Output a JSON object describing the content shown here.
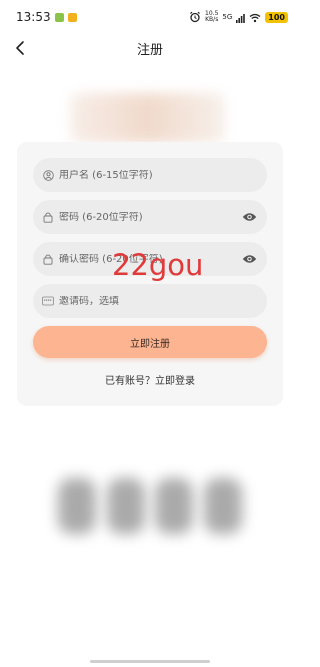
{
  "status_bar": {
    "time": "13:53",
    "network_speed_value": "10.5",
    "network_speed_unit": "KB/s",
    "network_type": "5G",
    "battery": "100"
  },
  "header": {
    "title": "注册"
  },
  "form": {
    "username_placeholder": "用户名 (6-15位字符)",
    "password_placeholder": "密码 (6-20位字符)",
    "confirm_password_placeholder": "确认密码 (6-20位字符)",
    "invite_code_placeholder": "邀请码，选填",
    "submit_label": "立即注册",
    "login_link": "已有账号？立即登录"
  },
  "watermark": "22gou",
  "colors": {
    "accent": "#fcb491",
    "watermark": "#e03a3a",
    "card_bg": "#f6f6f6",
    "field_bg": "#ececec"
  }
}
